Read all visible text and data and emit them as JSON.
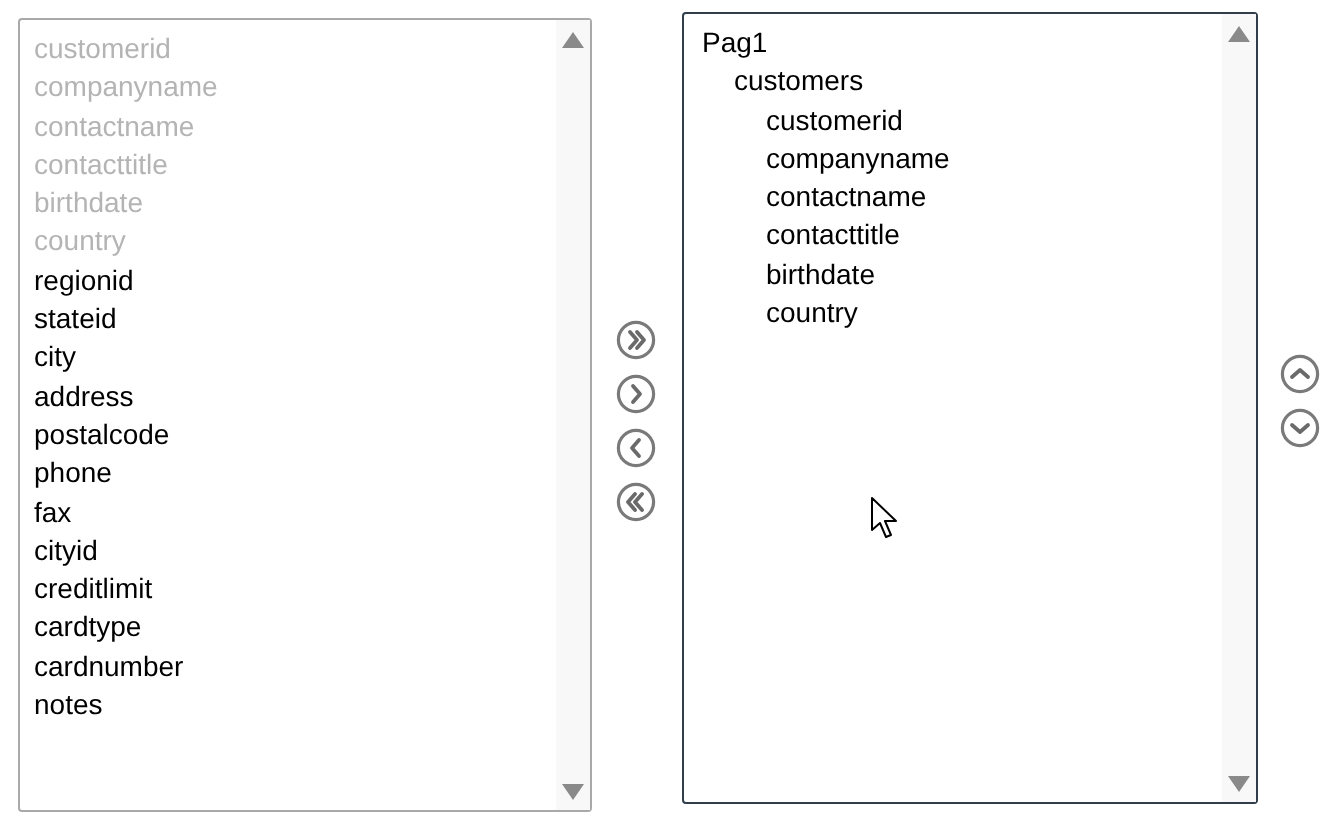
{
  "available_fields": [
    {
      "label": "customerid",
      "disabled": true
    },
    {
      "label": "companyname",
      "disabled": true
    },
    {
      "label": "contactname",
      "disabled": true
    },
    {
      "label": "contacttitle",
      "disabled": true
    },
    {
      "label": "birthdate",
      "disabled": true
    },
    {
      "label": "country",
      "disabled": true
    },
    {
      "label": "regionid",
      "disabled": false
    },
    {
      "label": "stateid",
      "disabled": false
    },
    {
      "label": "city",
      "disabled": false
    },
    {
      "label": "address",
      "disabled": false
    },
    {
      "label": "postalcode",
      "disabled": false
    },
    {
      "label": "phone",
      "disabled": false
    },
    {
      "label": "fax",
      "disabled": false
    },
    {
      "label": "cityid",
      "disabled": false
    },
    {
      "label": "creditlimit",
      "disabled": false
    },
    {
      "label": "cardtype",
      "disabled": false
    },
    {
      "label": "cardnumber",
      "disabled": false
    },
    {
      "label": "notes",
      "disabled": false
    }
  ],
  "transfer_buttons": [
    {
      "kind": "add-all"
    },
    {
      "kind": "add"
    },
    {
      "kind": "remove"
    },
    {
      "kind": "remove-all"
    }
  ],
  "selected_tree": [
    {
      "label": "Pag1",
      "children": [
        {
          "label": "customers",
          "children": [
            {
              "label": "customerid"
            },
            {
              "label": "companyname"
            },
            {
              "label": "contactname"
            },
            {
              "label": "contacttitle"
            },
            {
              "label": "birthdate"
            },
            {
              "label": "country"
            }
          ]
        }
      ]
    }
  ],
  "order_buttons": [
    {
      "kind": "up"
    },
    {
      "kind": "down"
    }
  ]
}
